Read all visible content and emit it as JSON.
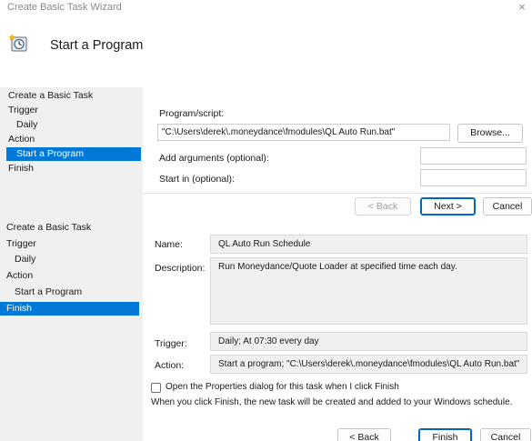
{
  "top_window": {
    "title": "Create Basic Task Wizard",
    "close_glyph": "×",
    "header_title": "Start a Program",
    "header_icon": "task-scheduler-icon",
    "sidebar": {
      "items": [
        {
          "label": "Create a Basic Task"
        },
        {
          "label": "Trigger"
        },
        {
          "label": "Daily"
        },
        {
          "label": "Action"
        },
        {
          "label": "Start a Program"
        },
        {
          "label": "Finish"
        }
      ]
    },
    "form": {
      "program_label": "Program/script:",
      "program_value": "\"C:\\Users\\derek\\.moneydance\\fmodules\\QL Auto Run.bat\"",
      "browse_label": "Browse...",
      "arguments_label": "Add arguments (optional):",
      "arguments_value": "",
      "start_in_label": "Start in (optional):",
      "start_in_value": ""
    },
    "buttons": {
      "back": "< Back",
      "next": "Next >",
      "cancel": "Cancel"
    }
  },
  "bottom_window": {
    "sidebar": {
      "items": [
        {
          "label": "Create a Basic Task"
        },
        {
          "label": "Trigger"
        },
        {
          "label": "Daily"
        },
        {
          "label": "Action"
        },
        {
          "label": "Start a Program"
        },
        {
          "label": "Finish"
        }
      ]
    },
    "summary": {
      "name_label": "Name:",
      "name_value": "QL Auto Run Schedule",
      "description_label": "Description:",
      "description_value": "Run Moneydance/Quote Loader at specified time each day.",
      "trigger_label": "Trigger:",
      "trigger_value": "Daily; At 07:30 every day",
      "action_label": "Action:",
      "action_value": "Start a program; \"C:\\Users\\derek\\.moneydance\\fmodules\\QL Auto Run.bat\""
    },
    "open_properties_label": "Open the Properties dialog for this task when I click Finish",
    "finish_note": "When you click Finish, the new task will be created and added to your Windows schedule.",
    "buttons": {
      "back": "< Back",
      "finish": "Finish",
      "cancel": "Cancel"
    }
  },
  "colors": {
    "selection": "#0078d7",
    "sidebar_bg": "#f0f0f0",
    "primary_border": "#0067c0"
  }
}
